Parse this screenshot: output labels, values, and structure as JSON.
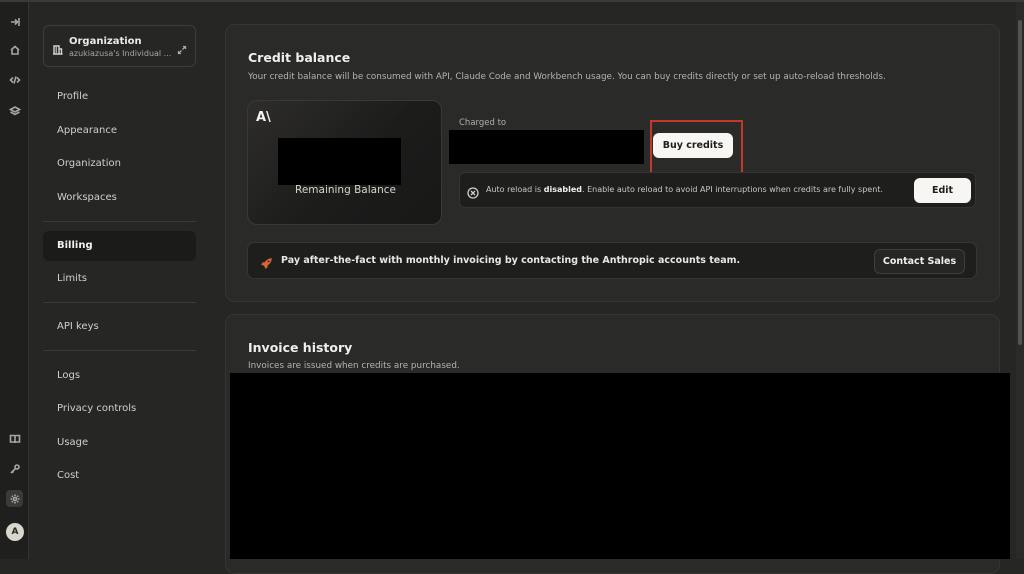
{
  "rail": {
    "icons": [
      "sidebar-toggle-icon",
      "home-icon",
      "code-icon",
      "layers-icon",
      "book-icon",
      "key-icon",
      "gear-icon"
    ],
    "avatar_letter": "A"
  },
  "org": {
    "title": "Organization",
    "subtitle": "azukiazusa's Individual ..."
  },
  "nav": {
    "profile": "Profile",
    "appearance": "Appearance",
    "organization": "Organization",
    "workspaces": "Workspaces",
    "billing": "Billing",
    "limits": "Limits",
    "api_keys": "API keys",
    "logs": "Logs",
    "privacy": "Privacy controls",
    "usage": "Usage",
    "cost": "Cost"
  },
  "credit": {
    "title": "Credit balance",
    "description": "Your credit balance will be consumed with API, Claude Code and Workbench usage. You can buy credits directly or set up auto-reload thresholds.",
    "logo": "A\\",
    "remaining_label": "Remaining Balance",
    "charged_to_label": "Charged to",
    "buy_button": "Buy credits",
    "autoreload_prefix": "Auto reload is ",
    "autoreload_state": "disabled",
    "autoreload_suffix": ". Enable auto reload to avoid API interruptions when credits are fully spent.",
    "edit_button": "Edit"
  },
  "invoicing": {
    "banner_text": "Pay after-the-fact with monthly invoicing by contacting the Anthropic accounts team.",
    "contact_button": "Contact Sales"
  },
  "invoice_history": {
    "title": "Invoice history",
    "description": "Invoices are issued when credits are purchased."
  },
  "colors": {
    "highlight_box": "#c0392b",
    "rocket": "#d9643a",
    "background": "#262624"
  }
}
